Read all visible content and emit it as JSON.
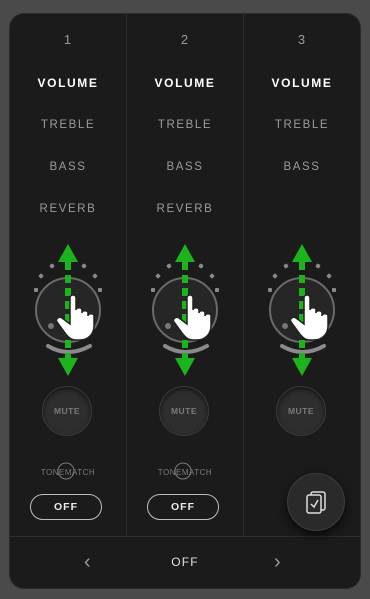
{
  "channels": [
    {
      "number": "1",
      "tabs": {
        "volume": "VOLUME",
        "treble": "TREBLE",
        "bass": "BASS",
        "reverb": "REVERB"
      },
      "mute_label": "MUTE",
      "tonematch_label": "TONEMATCH",
      "off_label": "OFF"
    },
    {
      "number": "2",
      "tabs": {
        "volume": "VOLUME",
        "treble": "TREBLE",
        "bass": "BASS",
        "reverb": "REVERB"
      },
      "mute_label": "MUTE",
      "tonematch_label": "TONEMATCH",
      "off_label": "OFF"
    },
    {
      "number": "3",
      "tabs": {
        "volume": "VOLUME",
        "treble": "TREBLE",
        "bass": "BASS"
      },
      "mute_label": "MUTE"
    }
  ],
  "bottom_bar": {
    "label": "OFF",
    "prev_icon": "chevron-left-icon",
    "next_icon": "chevron-right-icon"
  },
  "fab": {
    "icon": "presets-icon"
  },
  "gesture_hint": {
    "icon": "hand-pointer-icon",
    "direction": "vertical-drag",
    "color": "#1db31d"
  },
  "colors": {
    "panel": "#1b1b1b",
    "accent_green": "#1db31d",
    "text_active": "#ffffff",
    "text_inactive": "#9b9b9b"
  }
}
